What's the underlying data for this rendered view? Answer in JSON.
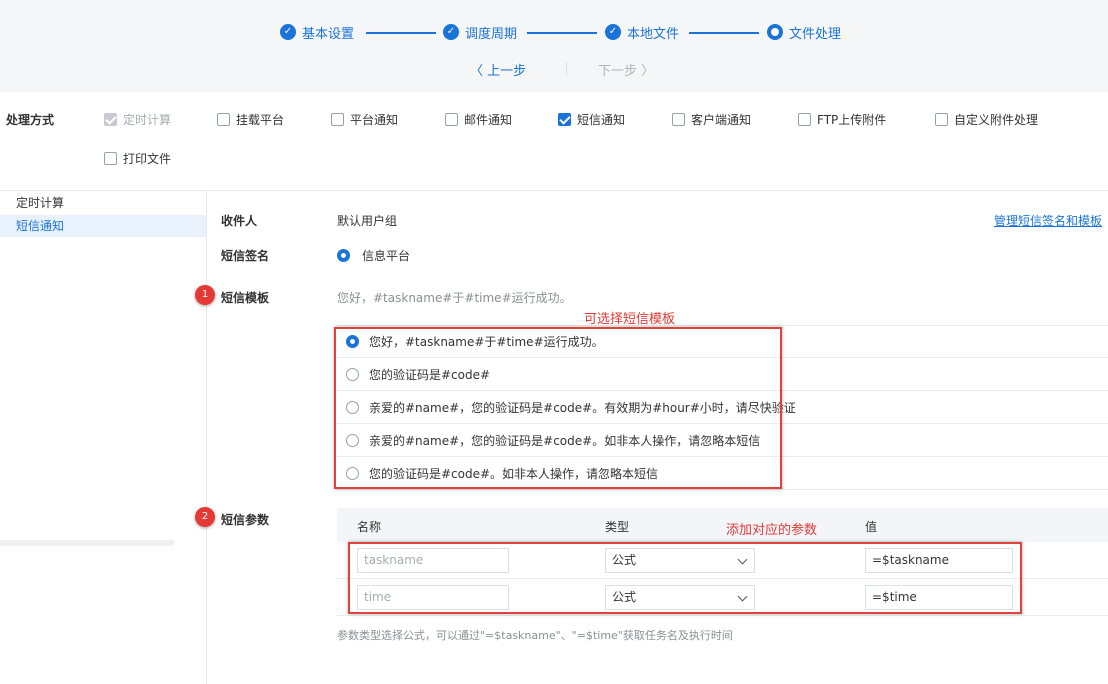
{
  "wizard": {
    "steps": [
      {
        "label": "基本设置",
        "state": "done"
      },
      {
        "label": "调度周期",
        "state": "done"
      },
      {
        "label": "本地文件",
        "state": "done"
      },
      {
        "label": "文件处理",
        "state": "current"
      }
    ],
    "prev_label": "〈 上一步",
    "next_label": "下一步 〉"
  },
  "mode": {
    "title": "处理方式",
    "options": [
      {
        "label": "定时计算",
        "checked": true,
        "disabled": true
      },
      {
        "label": "挂载平台",
        "checked": false
      },
      {
        "label": "平台通知",
        "checked": false
      },
      {
        "label": "邮件通知",
        "checked": false
      },
      {
        "label": "短信通知",
        "checked": true
      },
      {
        "label": "客户端通知",
        "checked": false
      },
      {
        "label": "FTP上传附件",
        "checked": false
      },
      {
        "label": "自定义附件处理",
        "checked": false
      },
      {
        "label": "打印文件",
        "checked": false
      }
    ]
  },
  "sidebar": {
    "items": [
      {
        "label": "定时计算",
        "active": false
      },
      {
        "label": "短信通知",
        "active": true
      }
    ]
  },
  "form": {
    "recipient_label": "收件人",
    "recipient_value": "默认用户组",
    "manage_link": "管理短信签名和模板",
    "signature_label": "短信签名",
    "signature_value": "信息平台",
    "template_label": "短信模板",
    "template_value": "您好，#taskname#于#time#运行成功。",
    "template_badge": "1",
    "template_annotation": "可选择短信模板",
    "templates": [
      {
        "text": "您好，#taskname#于#time#运行成功。",
        "selected": true
      },
      {
        "text": "您的验证码是#code#",
        "selected": false
      },
      {
        "text": "亲爱的#name#，您的验证码是#code#。有效期为#hour#小时，请尽快验证",
        "selected": false
      },
      {
        "text": "亲爱的#name#，您的验证码是#code#。如非本人操作，请忽略本短信",
        "selected": false
      },
      {
        "text": "您的验证码是#code#。如非本人操作，请忽略本短信",
        "selected": false
      }
    ],
    "params_label": "短信参数",
    "params_badge": "2",
    "params_annotation": "添加对应的参数",
    "params_columns": {
      "name": "名称",
      "type": "类型",
      "value": "值"
    },
    "params_rows": [
      {
        "name_placeholder": "taskname",
        "type": "公式",
        "value": "=$taskname"
      },
      {
        "name_placeholder": "time",
        "type": "公式",
        "value": "=$time"
      }
    ],
    "params_hint": "参数类型选择公式，可以通过\"=$taskname\"、\"=$time\"获取任务名及执行时间"
  },
  "colors": {
    "accent": "#1a73d8",
    "annotation": "#e53935"
  }
}
